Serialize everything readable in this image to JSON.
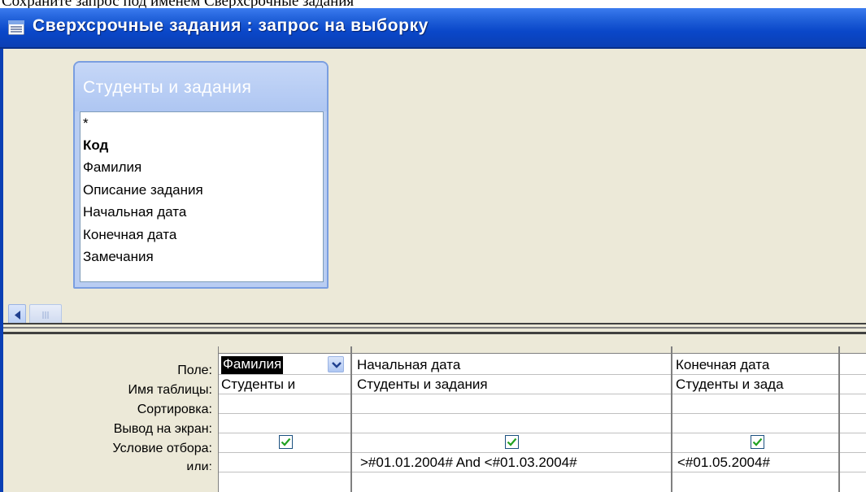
{
  "caption_above": "Сохраните запрос под именем Сверхсрочные задания",
  "window": {
    "title": "Сверхсрочные задания : запрос на выборку"
  },
  "field_list": {
    "title": "Студенты и задания",
    "items": [
      "*",
      "Код",
      "Фамилия",
      "Описание задания",
      "Начальная дата",
      "Конечная дата",
      "Замечания"
    ],
    "bold_item": "Код"
  },
  "grid": {
    "row_labels": {
      "field": "Поле:",
      "table": "Имя таблицы:",
      "sort": "Сортировка:",
      "show": "Вывод на экран:",
      "criteria": "Условие отбора:",
      "or": "или:"
    },
    "columns": [
      {
        "field": "Фамилия",
        "table": "Студенты и",
        "sort": "",
        "show": true,
        "criteria": "",
        "selected": true
      },
      {
        "field": "Начальная дата",
        "table": "Студенты и задания",
        "sort": "",
        "show": true,
        "criteria": ">#01.01.2004# And <#01.03.2004#",
        "selected": false
      },
      {
        "field": "Конечная дата",
        "table": "Студенты и зада",
        "sort": "",
        "show": true,
        "criteria": "<#01.05.2004#",
        "selected": false
      }
    ]
  },
  "icons": {
    "title_icon": "query-window-icon",
    "scroll_left": "scroll-left-arrow-icon",
    "dropdown": "chevron-down-icon",
    "checkmark": "checkmark-icon"
  },
  "colors": {
    "titlebar": "#0a47c9",
    "window_bg": "#ece9d8",
    "field_list_header": "#b9cdf2",
    "checkmark": "#21a121"
  }
}
